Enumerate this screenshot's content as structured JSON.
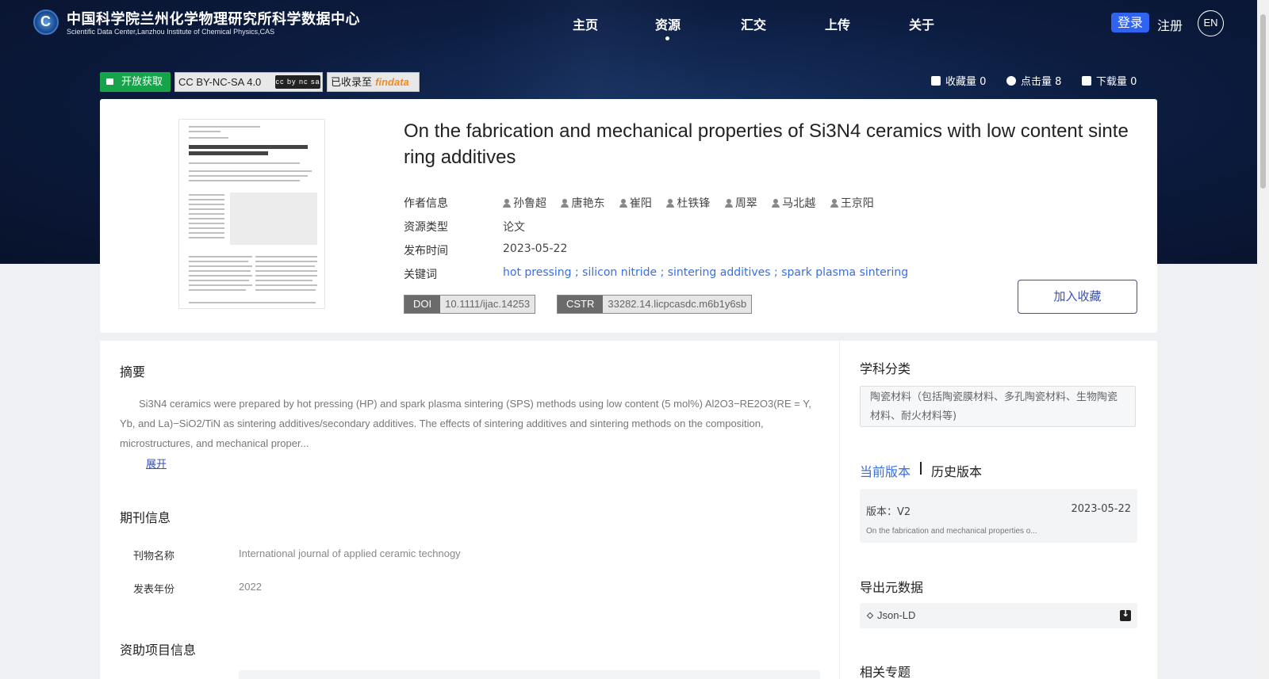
{
  "header": {
    "site_title": "中国科学院兰州化学物理研究所科学数据中心",
    "site_subtitle": "Scientific Data Center,Lanzhou Institute of Chemical Physics,CAS",
    "nav": [
      {
        "label": "主页"
      },
      {
        "label": "资源",
        "active": true
      },
      {
        "label": "汇交"
      },
      {
        "label": "上传"
      },
      {
        "label": "关于"
      }
    ],
    "login_label": "登录",
    "register_label": "注册",
    "lang_label": "EN"
  },
  "badges": {
    "open_access": "开放获取",
    "license": "CC BY-NC-SA 4.0",
    "cc_mark": "cc by nc sa",
    "indexed_prefix": "已收录至",
    "indexed_brand": "findata"
  },
  "stats": {
    "favorites": "收藏量 0",
    "clicks": "点击量 8",
    "downloads": "下载量 0"
  },
  "record": {
    "title": "On the fabrication and mechanical properties of Si3N4 ceramics with low content sintering additives",
    "labels": {
      "authors": "作者信息",
      "type": "资源类型",
      "date": "发布时间",
      "keywords": "关键词"
    },
    "authors": [
      "孙鲁超",
      "唐艳东",
      "崔阳",
      "杜铁锋",
      "周翠",
      "马北越",
      "王京阳"
    ],
    "type": "论文",
    "date": "2023-05-22",
    "keywords": "hot pressing ; silicon nitride ; sintering additives ; spark plasma sintering",
    "doi_label": "DOI",
    "doi": "10.1111/ijac.14253",
    "cstr_label": "CSTR",
    "cstr": "33282.14.licpcasdc.m6b1y6sb",
    "favorite_button": "加入收藏"
  },
  "abstract": {
    "heading": "摘要",
    "text": "Si3N4 ceramics were prepared by hot pressing (HP) and spark plasma sintering (SPS) methods using low content (5 mol%) Al2O3−RE2O3(RE = Y, Yb, and La)−SiO2/TiN as sintering additives/secondary additives. The effects of sintering additives and sintering methods on the composition, microstructures, and mechanical proper...",
    "expand_label": "展开"
  },
  "journal": {
    "heading": "期刊信息",
    "name_label": "刊物名称",
    "name": "International journal of applied ceramic technogy",
    "year_label": "发表年份",
    "year": "2022"
  },
  "funding": {
    "heading": "资助项目信息"
  },
  "sidebar": {
    "subject_heading": "学科分类",
    "subject": "陶瓷材料（包括陶瓷膜材料、多孔陶瓷材料、生物陶瓷材料、耐火材料等)",
    "version_current": "当前版本",
    "version_history": "历史版本",
    "version_name": "版本：V2",
    "version_date": "2023-05-22",
    "version_desc": "On the fabrication and mechanical properties o...",
    "export_heading": "导出元数据",
    "export_format": "Json-LD",
    "topics_heading": "相关专题"
  }
}
